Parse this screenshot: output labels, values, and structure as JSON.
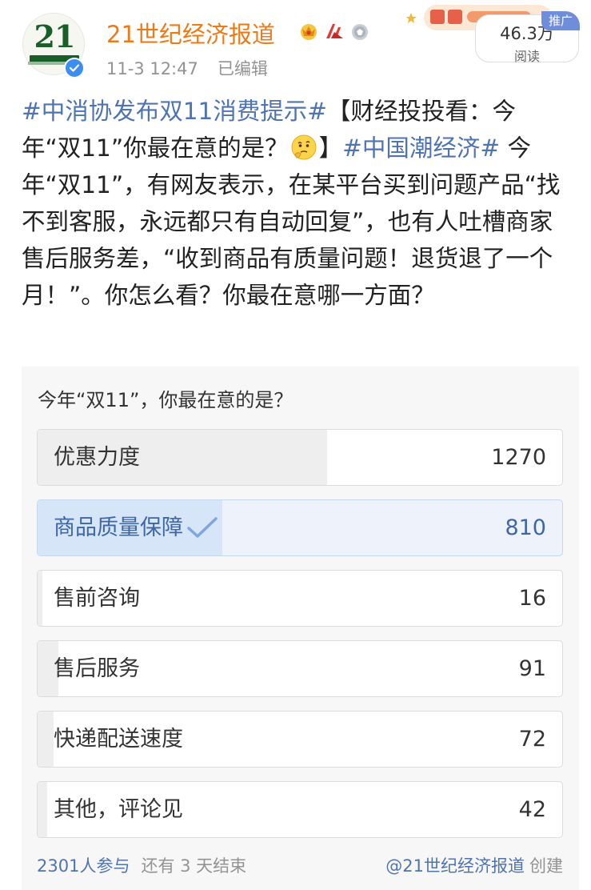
{
  "user": {
    "name": "21世纪经济报道",
    "avatar_text": "21",
    "timestamp": "11-3 12:47",
    "edited_label": "已编辑",
    "badges": [
      "crown-icon",
      "red-arrow-icon",
      "medal-icon"
    ]
  },
  "read_count": {
    "value": "46.3万",
    "label": "阅读"
  },
  "promo_tag": "推广",
  "post": {
    "topic_1": "#中消协发布双11消费提示#",
    "text_1": "【财经投投看：今年“双11”你最在意的是？",
    "text_2": "】",
    "topic_2": "#中国潮经济#",
    "text_3": " 今年“双11”，有网友表示，在某平台买到问题产品“找不到客服，永远都只有自动回复”，也有人吐槽商家售后服务差，“收到商品有质量问题！退货退了一个月！”。你怎么看？你最在意哪一方面？"
  },
  "poll": {
    "question": "今年“双11”，你最在意的是？",
    "options": [
      {
        "label": "优惠力度",
        "count": "1270",
        "share": 0.552,
        "chosen": false
      },
      {
        "label": "商品质量保障",
        "count": "810",
        "share": 0.352,
        "chosen": true
      },
      {
        "label": "售前咨询",
        "count": "16",
        "share": 0.007,
        "chosen": false
      },
      {
        "label": "售后服务",
        "count": "91",
        "share": 0.04,
        "chosen": false
      },
      {
        "label": "快递配送速度",
        "count": "72",
        "share": 0.031,
        "chosen": false
      },
      {
        "label": "其他，评论见",
        "count": "42",
        "share": 0.018,
        "chosen": false
      }
    ],
    "participants": "2301人参与",
    "remaining": "还有 3 天结束",
    "creator": "@21世纪经济报道",
    "created_label": "创建"
  },
  "colors": {
    "username": "#ee7a16",
    "link": "#4f74b1",
    "chosen_fill": "#d6e5f8",
    "bar_fill": "#eeeeee"
  }
}
